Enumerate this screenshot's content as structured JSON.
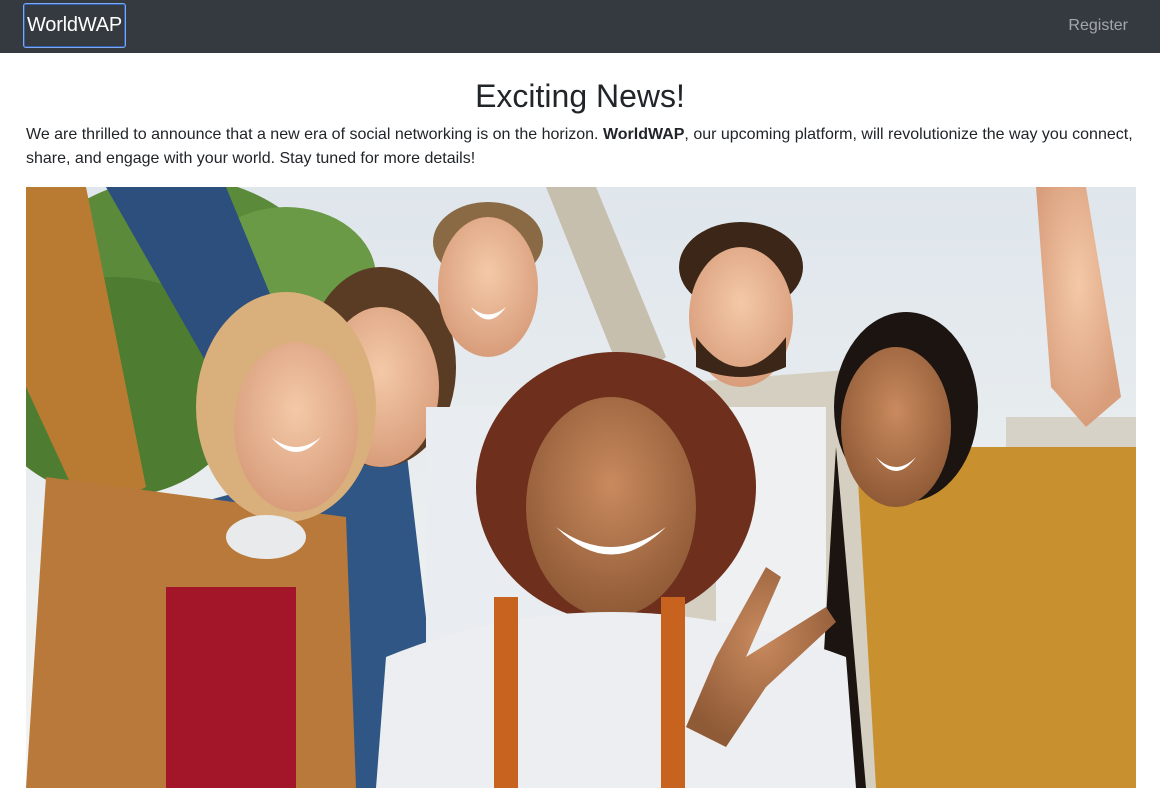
{
  "navbar": {
    "brand": "WorldWAP",
    "register_label": "Register",
    "background": "#343a40"
  },
  "main": {
    "title": "Exciting News!",
    "announcement": {
      "before": "We are thrilled to announce that a new era of social networking is on the horizon. ",
      "brand": "WorldWAP",
      "after": ", our upcoming platform, will revolutionize the way you connect, share, and engage with your world. Stay tuned for more details!"
    },
    "hero_image": {
      "alt": "Group of smiling friends taking a selfie outdoors"
    }
  }
}
